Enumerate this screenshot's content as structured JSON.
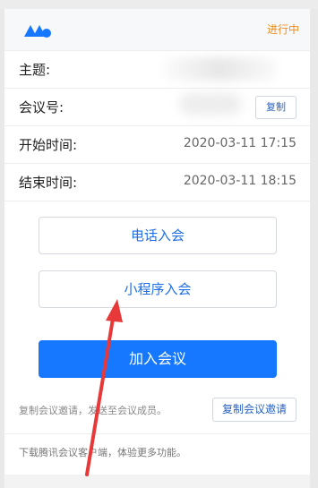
{
  "header": {
    "status": "进行中",
    "logo_icon": "tencent-meeting-logo-icon"
  },
  "rows": {
    "topic_label": "主题:",
    "meeting_id_label": "会议号:",
    "copy_label": "复制",
    "start_label": "开始时间:",
    "start_value": "2020-03-11 17:15",
    "end_label": "结束时间:",
    "end_value": "2020-03-11 18:15"
  },
  "actions": {
    "phone_join": "电话入会",
    "miniprogram_join": "小程序入会",
    "join_meeting": "加入会议"
  },
  "invite": {
    "text": "复制会议邀请，发送至会议成员。",
    "button": "复制会议邀请"
  },
  "download": {
    "text": "下载腾讯会议客户端，体验更多功能。"
  },
  "colors": {
    "accent": "#1677ff",
    "status": "#f08c1a",
    "annotation_arrow": "#e8393a"
  }
}
